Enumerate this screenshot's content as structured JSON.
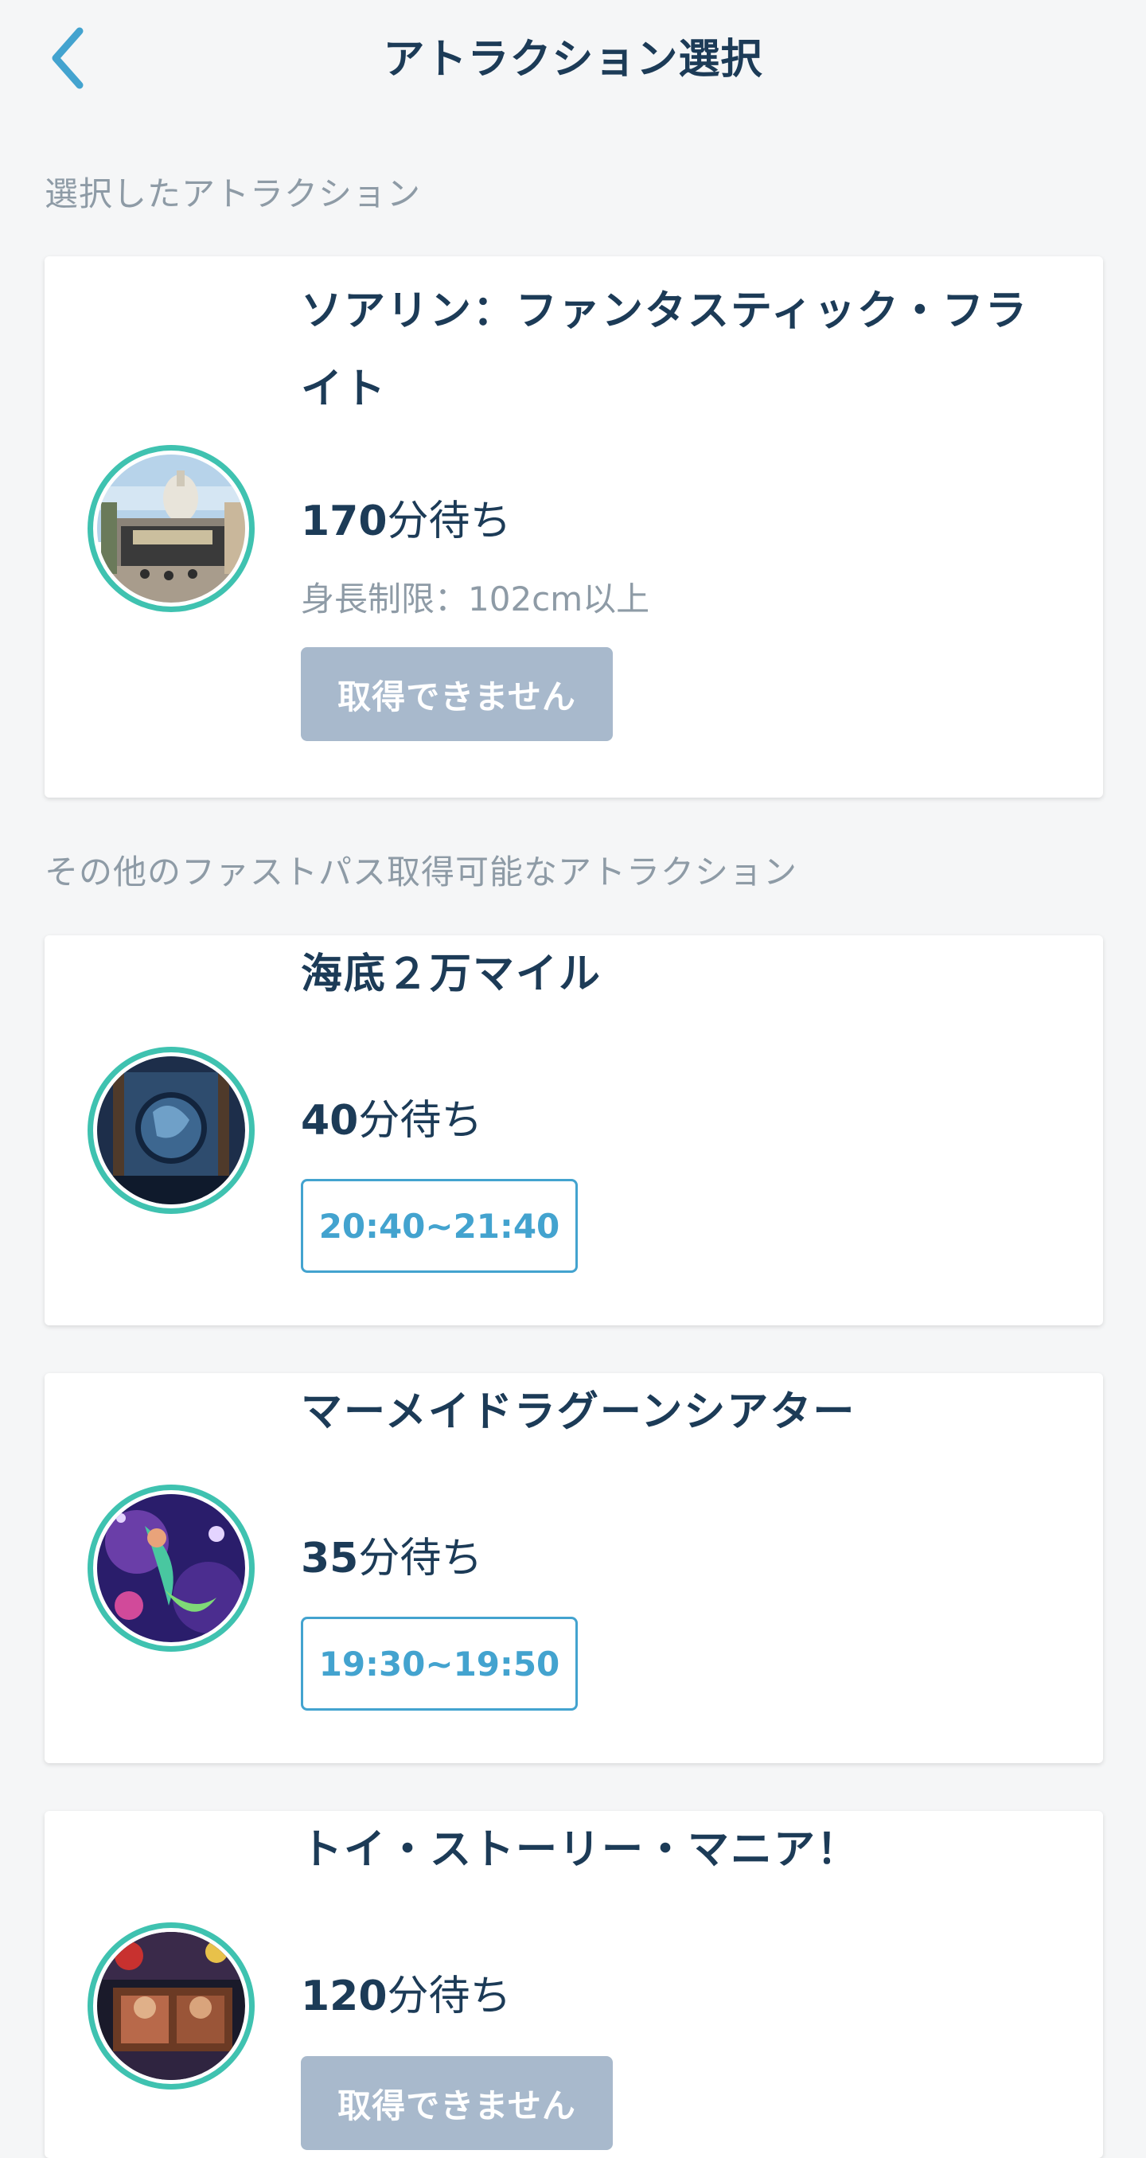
{
  "header": {
    "title": "アトラクション選択",
    "back_icon": "chevron-left-icon"
  },
  "colors": {
    "title": "#1c3b57",
    "muted": "#8e9ba6",
    "ring": "#3fc2b0",
    "accent": "#43a3cf",
    "disabled_button": "#a8b9cc"
  },
  "selected": {
    "section_label": "選択したアトラクション",
    "attraction": {
      "name": "ソアリン：ファンタスティック・フライト",
      "wait_number": "170",
      "wait_suffix": "分待ち",
      "restriction": "身長制限：102cm以上",
      "button_label": "取得できません"
    }
  },
  "others": {
    "section_label": "その他のファストパス取得可能なアトラクション",
    "attractions": [
      {
        "name": "海底２万マイル",
        "wait_number": "40",
        "wait_suffix": "分待ち",
        "button_label": "20:40~21:40"
      },
      {
        "name": "マーメイドラグーンシアター",
        "wait_number": "35",
        "wait_suffix": "分待ち",
        "button_label": "19:30~19:50"
      },
      {
        "name": "トイ・ストーリー・マニア！",
        "wait_number": "120",
        "wait_suffix": "分待ち",
        "button_label": "取得できません"
      }
    ]
  }
}
